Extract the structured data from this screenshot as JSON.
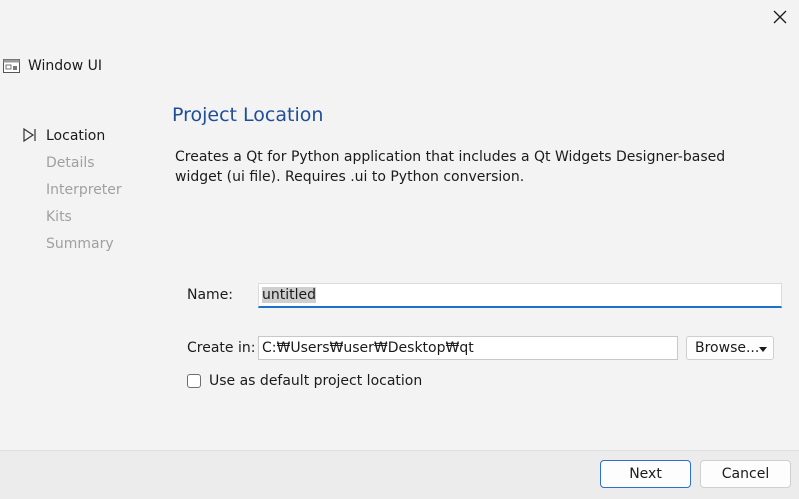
{
  "window": {
    "title": "Window UI",
    "icon": "window-app-icon",
    "close_icon": "close-icon"
  },
  "sidebar": {
    "items": [
      {
        "label": "Location",
        "active": true
      },
      {
        "label": "Details",
        "active": false
      },
      {
        "label": "Interpreter",
        "active": false
      },
      {
        "label": "Kits",
        "active": false
      },
      {
        "label": "Summary",
        "active": false
      }
    ],
    "active_icon": "play-outline-icon"
  },
  "page": {
    "title": "Project Location",
    "description": "Creates a Qt for Python application that includes a Qt Widgets Designer-based widget (ui file). Requires .ui to Python conversion."
  },
  "form": {
    "name_label": "Name:",
    "name_value": "untitled",
    "create_in_label": "Create in:",
    "create_in_value": "C:₩Users₩user₩Desktop₩qt",
    "browse_label": "Browse...",
    "default_location_label": "Use as default project location",
    "default_location_checked": false
  },
  "footer": {
    "next_label": "Next",
    "cancel_label": "Cancel"
  },
  "colors": {
    "accent": "#1f6fcf",
    "title": "#1f4e99",
    "disabled_text": "#a0a0a0"
  }
}
